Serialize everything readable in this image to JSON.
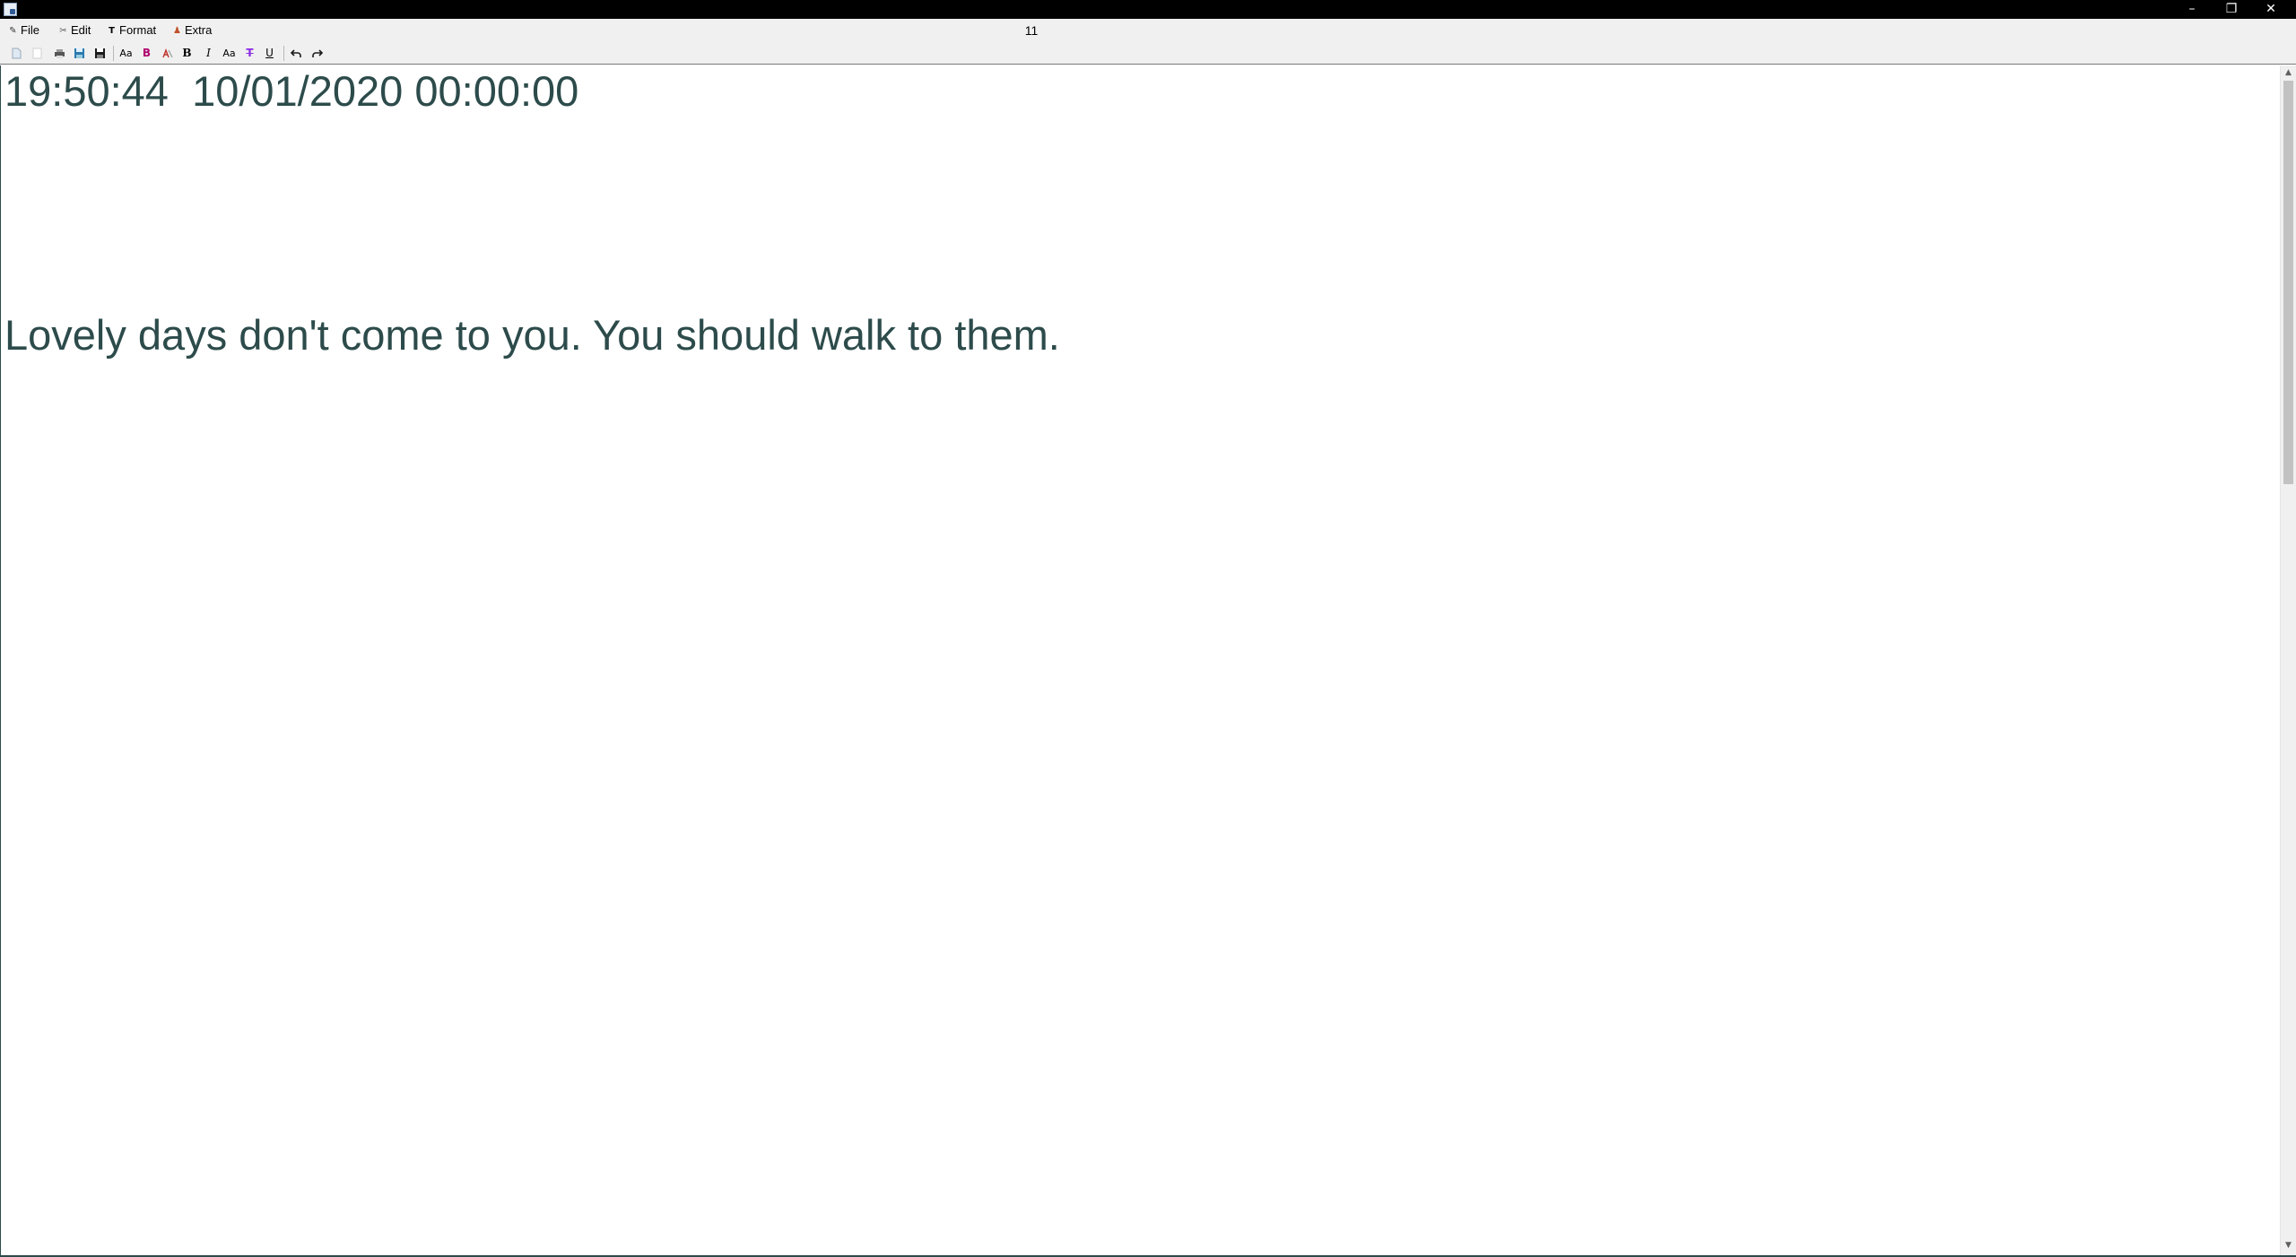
{
  "window": {
    "icon": "app-icon",
    "minimize_glyph": "–",
    "restore_glyph": "❐",
    "close_glyph": "✕"
  },
  "menu": {
    "items": [
      {
        "label": "File",
        "icon": "pen-icon",
        "glyph": "✎"
      },
      {
        "label": "Edit",
        "icon": "edit-icon",
        "glyph": "✂"
      },
      {
        "label": "Format",
        "icon": "format-icon",
        "glyph": "T"
      },
      {
        "label": "Extra",
        "icon": "extra-icon",
        "glyph": "♟"
      }
    ]
  },
  "document_title": "11",
  "toolbar": {
    "font_a_label": "Aa",
    "bold_color_label": "B",
    "bold_label": "B",
    "italic_label": "I",
    "font_b_label": "Aa",
    "strike_label": "T",
    "underline_label": "U"
  },
  "colors": {
    "text": "#2d4b4b",
    "bold_color": "#b0006e",
    "strike_color": "#8a2be2",
    "undo": "#1a1a1a"
  },
  "editor": {
    "timestamp_line": "19:50:44  10/01/2020 00:00:00",
    "quote_line": "Lovely days don't come to you. You should walk to them."
  }
}
